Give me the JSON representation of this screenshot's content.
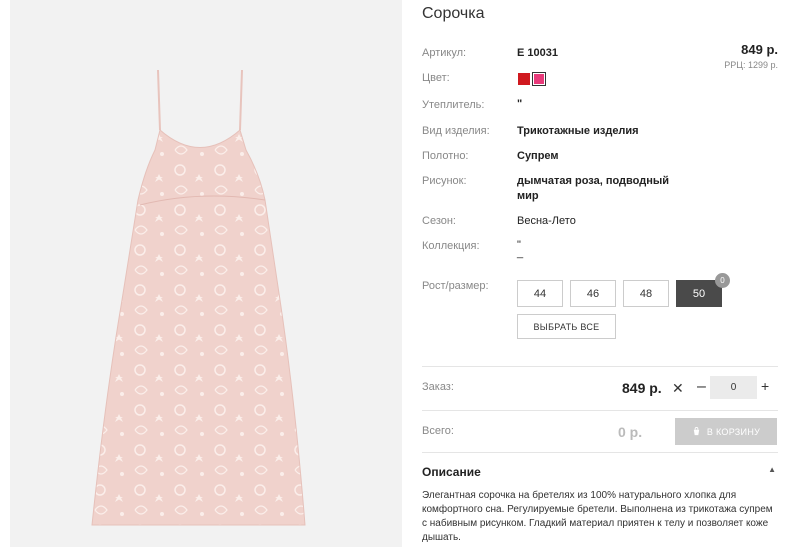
{
  "product": {
    "title": "Сорочка",
    "price": "849 р.",
    "rrp": "РРЦ: 1299 р."
  },
  "image": {
    "icon": "dress-photo"
  },
  "attributes": [
    {
      "label": "Артикул:",
      "value": "Е 10031"
    },
    {
      "label": "Цвет:"
    },
    {
      "label": "Утеплитель:",
      "value": "\""
    },
    {
      "label": "Вид изделия:",
      "value": "Трикотажные изделия"
    },
    {
      "label": "Полотно:",
      "value": "Супрем"
    },
    {
      "label": "Рисунок:",
      "value": "дымчатая роза, подводный мир"
    },
    {
      "label": "Сезон:",
      "value": "Весна-Лето"
    },
    {
      "label": "Коллекция:",
      "value": "\""
    }
  ],
  "colors": [
    "#d0191f",
    "#e83a7a"
  ],
  "sizes": {
    "label": "Рост/размер:",
    "options": [
      "44",
      "46",
      "48",
      "50"
    ],
    "selected": "50",
    "badge": "0",
    "select_all": "ВЫБРАТЬ ВСЕ"
  },
  "order": {
    "label": "Заказ:",
    "price": "849 р.",
    "times": "✕",
    "minus": "–",
    "quantity": "0",
    "plus": "+"
  },
  "total": {
    "label": "Всего:",
    "value": "0 р.",
    "cart_button": "В КОРЗИНУ",
    "cart_icon": "cart-icon"
  },
  "description": {
    "heading": "Описание",
    "text": "Элегантная сорочка на бретелях из 100% натурального хлопка для комфортного сна. Регулируемые бретели. Выполнена из трикотажа супрем с набивным рисунком. Гладкий материал приятен к телу и позволяет коже дышать."
  }
}
